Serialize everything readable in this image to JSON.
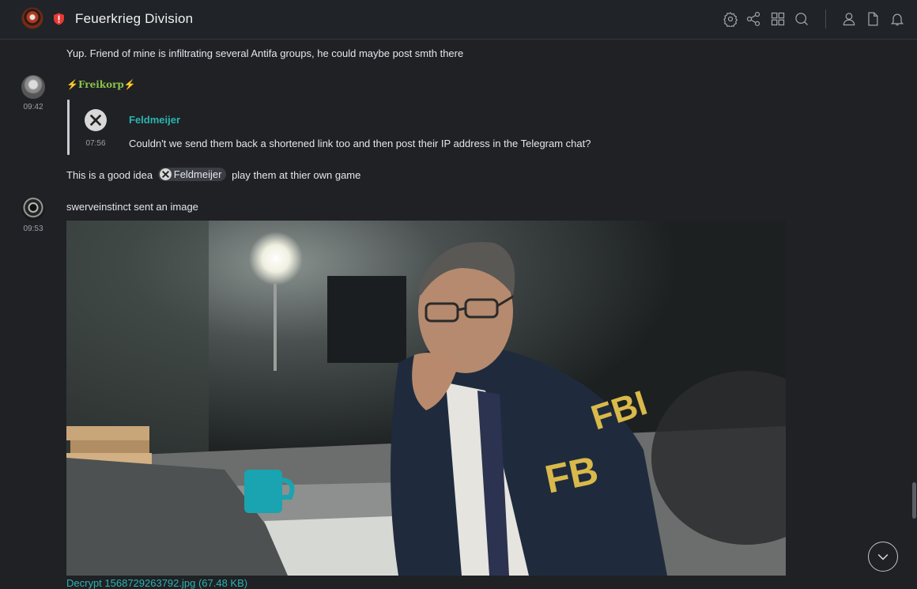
{
  "header": {
    "room_name": "Feuerkrieg Division",
    "icons": [
      "settings-icon",
      "share-icon",
      "apps-icon",
      "search-icon",
      "members-icon",
      "files-icon",
      "notifications-icon"
    ]
  },
  "messages": {
    "m0_text": "Yup. Friend of mine is infiltrating several Antifa groups, he could maybe post smth there",
    "m1": {
      "sender": "Freikorp",
      "time": "09:42",
      "quote": {
        "sender": "Feldmeijer",
        "time": "07:56",
        "text": "Couldn't we send them back a shortened link too and then post their IP address in the Telegram chat?"
      },
      "text_before": "This is a good idea",
      "mention": "Feldmeijer",
      "text_after": "play them at thier own game"
    },
    "m2": {
      "time": "09:53",
      "text": "swerveinstinct sent an image",
      "file_link": "Decrypt 1568729263792.jpg (67.48 KB)"
    }
  },
  "colors": {
    "background": "#1f2125",
    "accent_teal": "#2bb5b0",
    "freikorp_green": "#8bc34a",
    "bolt_yellow": "#f5c518",
    "badge_red": "#e53935"
  }
}
